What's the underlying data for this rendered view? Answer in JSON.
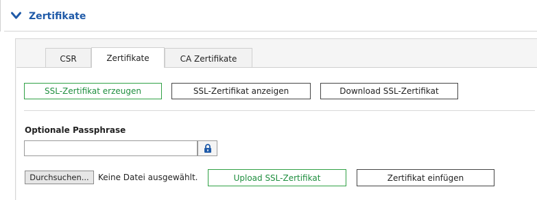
{
  "section": {
    "title": "Zertifikate",
    "accent_color": "#1f5aa8",
    "icon": "chevron-down-icon"
  },
  "tabs": [
    {
      "label": "CSR",
      "active": false
    },
    {
      "label": "Zertifikate",
      "active": true
    },
    {
      "label": "CA Zertifikate",
      "active": false
    }
  ],
  "actions": {
    "generate_label": "SSL-Zertifikat erzeugen",
    "show_label": "SSL-Zertifikat anzeigen",
    "download_label": "Download SSL-Zertifikat"
  },
  "passphrase": {
    "label": "Optionale Passphrase",
    "value": "",
    "icon": "lock-icon"
  },
  "file_upload": {
    "browse_label": "Durchsuchen...",
    "status_text": "Keine Datei ausgewählt.",
    "upload_label": "Upload SSL-Zertifikat",
    "insert_label": "Zertifikat einfügen"
  },
  "colors": {
    "primary_button_border": "#2ea043",
    "primary_button_text": "#1e8e3e"
  }
}
